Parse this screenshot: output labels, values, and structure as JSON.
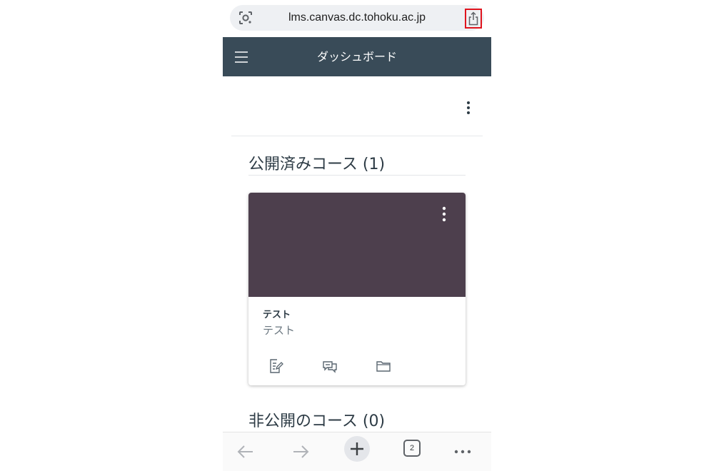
{
  "browser": {
    "url": "lms.canvas.dc.tohoku.ac.jp",
    "tab_count": "2"
  },
  "header": {
    "title": "ダッシュボード"
  },
  "sections": {
    "published_title": "公開済みコース (1)",
    "unpublished_title": "非公開のコース (0)"
  },
  "course_card": {
    "name": "テスト",
    "code": "テスト",
    "hero_color": "#4d3f4d"
  },
  "colors": {
    "header_bg": "#394b58",
    "highlight": "#e0141e"
  },
  "icons": {
    "lens": "google-lens-icon",
    "share": "share-icon",
    "menu": "hamburger-menu-icon",
    "more": "more-vertical-icon",
    "assignments": "assignment-icon",
    "discussions": "discussion-icon",
    "files": "folder-icon",
    "back": "arrow-left-icon",
    "forward": "arrow-right-icon",
    "new_tab": "plus-icon",
    "tabs": "tab-switcher-icon",
    "overflow": "more-horizontal-icon"
  }
}
